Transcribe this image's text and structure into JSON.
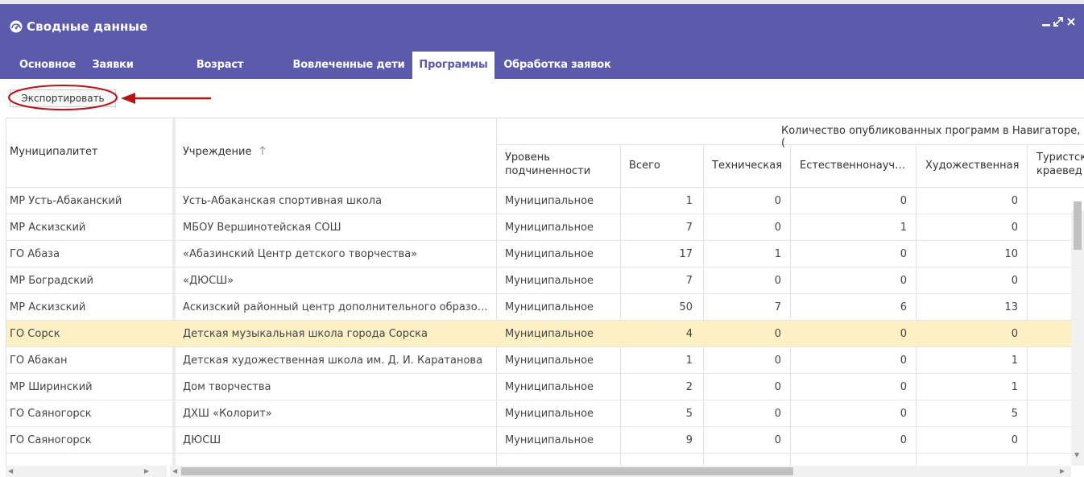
{
  "window": {
    "title": "Сводные данные",
    "icon": "dashboard-icon",
    "controls": [
      "minimize-icon",
      "maximize-icon",
      "close-icon"
    ]
  },
  "tabs": [
    {
      "label": "Основное",
      "active": false
    },
    {
      "label": "Заявки",
      "active": false
    },
    {
      "label": "Возраст обучающихся",
      "active": false
    },
    {
      "label": "Вовлеченные дети",
      "active": false
    },
    {
      "label": "Программы",
      "active": true
    },
    {
      "label": "Обработка заявок",
      "active": false
    }
  ],
  "toolbar": {
    "export_label": "Экспортировать"
  },
  "table": {
    "group_header": "Количество опубликованных программ в Навигаторе, (",
    "columns": {
      "municipality": "Муниципалитет",
      "institution": "Учреждение",
      "level": "Уровень подчиненности",
      "total": "Всего",
      "technical": "Техническая",
      "natural": "Естественнонауч…",
      "art": "Художественная",
      "tourism": "Туристск краевед"
    },
    "sort_icon": "sort-up-icon",
    "rows": [
      {
        "municipality": "МР Усть-Абаканский",
        "institution": "Усть-Абаканская спортивная школа",
        "level": "Муниципальное",
        "total": "1",
        "technical": "0",
        "natural": "0",
        "art": "0",
        "selected": false
      },
      {
        "municipality": "МР Аскизский",
        "institution": "МБОУ Вершинотейская СОШ",
        "level": "Муниципальное",
        "total": "7",
        "technical": "0",
        "natural": "1",
        "art": "0",
        "selected": false
      },
      {
        "municipality": "ГО Абаза",
        "institution": "«Абазинский Центр детского творчества»",
        "level": "Муниципальное",
        "total": "17",
        "technical": "1",
        "natural": "0",
        "art": "10",
        "selected": false
      },
      {
        "municipality": "МР Боградский",
        "institution": "«ДЮСШ»",
        "level": "Муниципальное",
        "total": "7",
        "technical": "0",
        "natural": "0",
        "art": "0",
        "selected": false
      },
      {
        "municipality": "МР Аскизский",
        "institution": "Аскизский районный центр дополнительного образова...",
        "level": "Муниципальное",
        "total": "50",
        "technical": "7",
        "natural": "6",
        "art": "13",
        "selected": false
      },
      {
        "municipality": "ГО Сорск",
        "institution": "Детская музыкальная школа города Сорска",
        "level": "Муниципальное",
        "total": "4",
        "technical": "0",
        "natural": "0",
        "art": "0",
        "selected": true
      },
      {
        "municipality": "ГО Абакан",
        "institution": "Детская художественная школа им. Д. И. Каратанова",
        "level": "Муниципальное",
        "total": "1",
        "technical": "0",
        "natural": "0",
        "art": "1",
        "selected": false
      },
      {
        "municipality": "МР Ширинский",
        "institution": "Дом творчества",
        "level": "Муниципальное",
        "total": "2",
        "technical": "0",
        "natural": "0",
        "art": "1",
        "selected": false
      },
      {
        "municipality": "ГО Саяногорск",
        "institution": "ДХШ «Колорит»",
        "level": "Муниципальное",
        "total": "5",
        "technical": "0",
        "natural": "0",
        "art": "5",
        "selected": false
      },
      {
        "municipality": "ГО Саяногорск",
        "institution": "ДЮСШ",
        "level": "Муниципальное",
        "total": "9",
        "technical": "0",
        "natural": "0",
        "art": "0",
        "selected": false
      }
    ]
  },
  "colors": {
    "accent": "#5b5aab",
    "selected_row": "#fdf0c4",
    "annotation": "#b3151b"
  }
}
